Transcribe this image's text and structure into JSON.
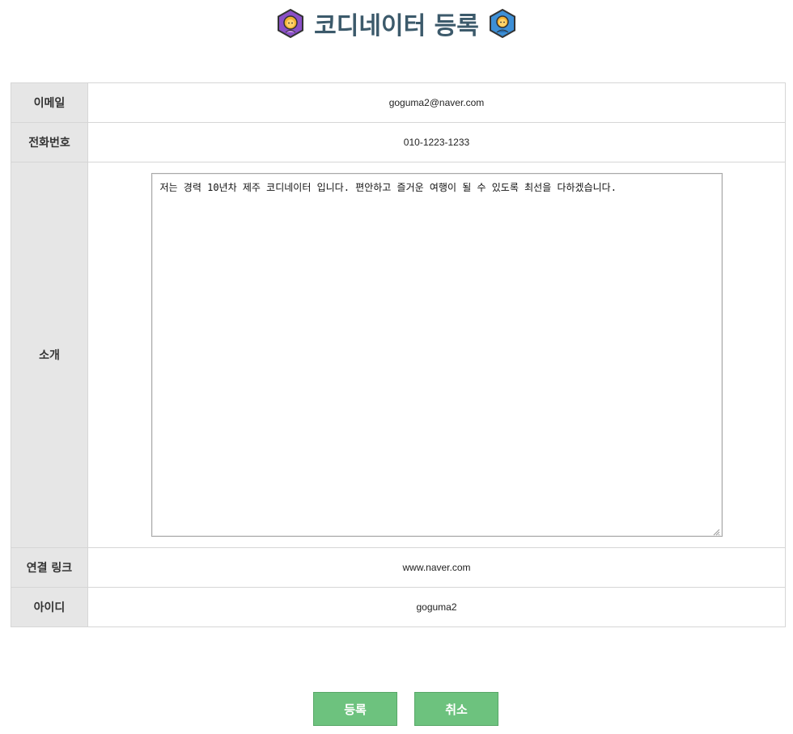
{
  "header": {
    "title": "코디네이터 등록",
    "left_icon": "woman-hexagon-icon",
    "right_icon": "man-hexagon-icon",
    "left_icon_color": "#8a4fc7",
    "right_icon_color": "#3d8fd6"
  },
  "form": {
    "email": {
      "label": "이메일",
      "value": "goguma2@naver.com"
    },
    "phone": {
      "label": "전화번호",
      "value": "010-1223-1233"
    },
    "intro": {
      "label": "소개",
      "value": "저는 경력 10년차 제주 코디네이터 입니다. 편안하고 즐거운 여행이 될 수 있도록 최선을 다하겠습니다."
    },
    "link": {
      "label": "연결 링크",
      "value": "www.naver.com"
    },
    "user_id": {
      "label": "아이디",
      "value": "goguma2"
    }
  },
  "buttons": {
    "register_label": "등록",
    "cancel_label": "취소",
    "color": "#6dc27e"
  }
}
